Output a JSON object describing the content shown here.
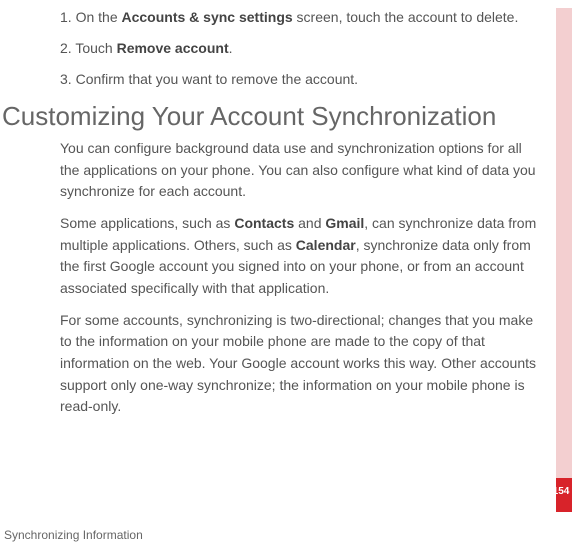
{
  "steps": [
    {
      "num": "1.",
      "prefix": "On the ",
      "bold": "Accounts & sync settings",
      "suffix": " screen, touch the account to delete."
    },
    {
      "num": "2.",
      "prefix": "Touch ",
      "bold": "Remove account",
      "suffix": "."
    },
    {
      "num": "3.",
      "prefix": "Confirm that you want to remove the account.",
      "bold": "",
      "suffix": ""
    }
  ],
  "heading": "Customizing Your Account Synchronization",
  "para1": "You can configure background data use and synchronization options for all the applications on your phone. You can also configure what kind of data you synchronize for each account.",
  "para2_parts": {
    "a": "Some applications, such as ",
    "b": "Contacts",
    "c": " and ",
    "d": "Gmail",
    "e": ", can synchronize data from multiple applications. Others, such as ",
    "f": "Calendar",
    "g": ", synchronize data only from the first Google account you signed into on your phone, or from an account associated specifically with that application."
  },
  "para3": "For some accounts, synchronizing is two-directional; changes that you make to the information on your mobile phone are made to the copy of that information on the web. Your Google account works this way. Other accounts support only one-way synchronize; the information on your mobile phone is read-only.",
  "footer": "Synchronizing Information",
  "page_num": "154"
}
